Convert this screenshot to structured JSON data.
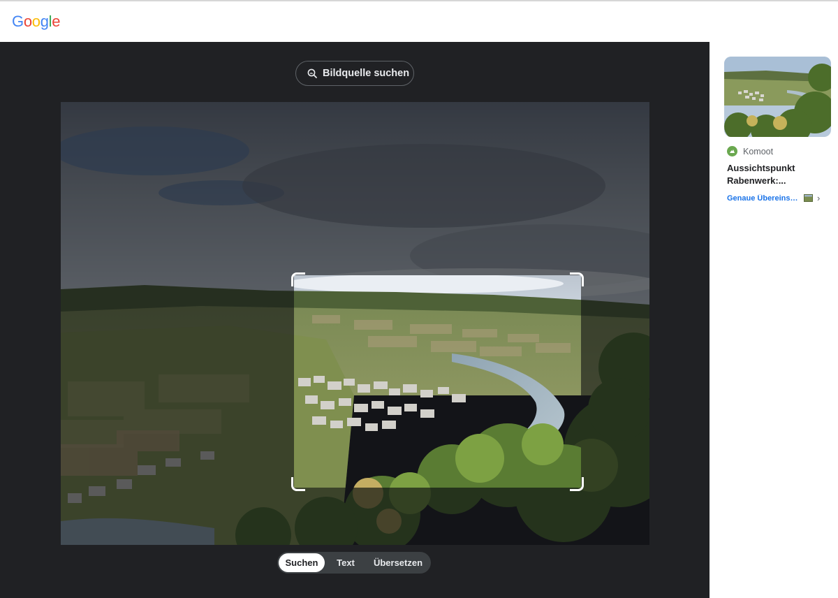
{
  "header": {
    "logo_text": [
      "G",
      "o",
      "o",
      "g",
      "l",
      "e"
    ],
    "logo_colors": [
      "#4285F4",
      "#EA4335",
      "#FBBC05",
      "#4285F4",
      "#34A853",
      "#EA4335"
    ]
  },
  "lens": {
    "source_button_label": "Bildquelle suchen",
    "tabs": [
      {
        "label": "Suchen",
        "active": true
      },
      {
        "label": "Text",
        "active": false
      },
      {
        "label": "Übersetzen",
        "active": false
      }
    ]
  },
  "results": {
    "cards": [
      {
        "source": "Komoot",
        "title_line1": "Aussichtspunkt",
        "title_line2": "Rabenwerk:...",
        "match_label": "Genaue Übereinsti..."
      }
    ]
  },
  "colors": {
    "pane_background": "#202124",
    "accent_link": "#1a73e8"
  }
}
